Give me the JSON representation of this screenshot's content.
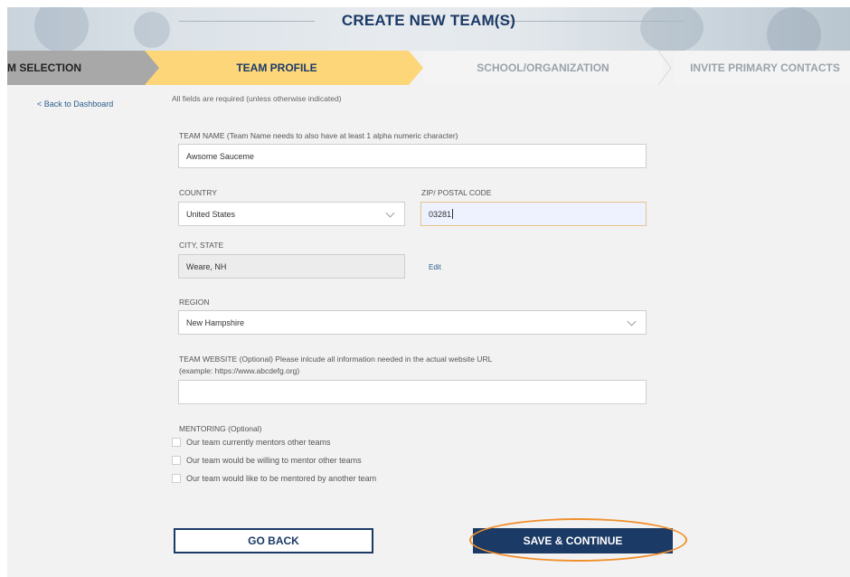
{
  "banner": {
    "title": "CREATE NEW TEAM(S)"
  },
  "steps": [
    {
      "label": "M SELECTION",
      "state": "done"
    },
    {
      "label": "TEAM PROFILE",
      "state": "active"
    },
    {
      "label": "SCHOOL/ORGANIZATION",
      "state": "pending"
    },
    {
      "label": "INVITE PRIMARY CONTACTS",
      "state": "pending"
    }
  ],
  "sidebar": {
    "back_link": "< Back to Dashboard"
  },
  "form": {
    "required_note": "All fields are required (unless otherwise indicated)",
    "team_name": {
      "label": "TEAM NAME (Team Name needs to also have at least 1 alpha numeric character)",
      "value": "Awsome Sauceme"
    },
    "country": {
      "label": "COUNTRY",
      "value": "United States"
    },
    "zip": {
      "label": "ZIP/ POSTAL CODE",
      "value": "03281"
    },
    "city_state": {
      "label": "CITY, STATE",
      "value": "Weare, NH",
      "edit_label": "Edit"
    },
    "region": {
      "label": "REGION",
      "value": "New Hampshire"
    },
    "website": {
      "label_line1": "TEAM WEBSITE (Optional) Please inlcude all information needed in the actual website URL",
      "label_line2": "(example: https://www.abcdefg.org)",
      "value": ""
    },
    "mentoring": {
      "label": "MENTORING (Optional)",
      "options": [
        {
          "label": "Our team currently mentors other teams",
          "checked": false
        },
        {
          "label": "Our team would be willing to mentor other teams",
          "checked": false
        },
        {
          "label": "Our team would like to be mentored by another team",
          "checked": false
        }
      ]
    }
  },
  "buttons": {
    "go_back": "GO BACK",
    "save_continue": "SAVE & CONTINUE"
  },
  "colors": {
    "navy": "#1b3a66",
    "active_step": "#fdd67a",
    "highlight": "#f0902e"
  }
}
